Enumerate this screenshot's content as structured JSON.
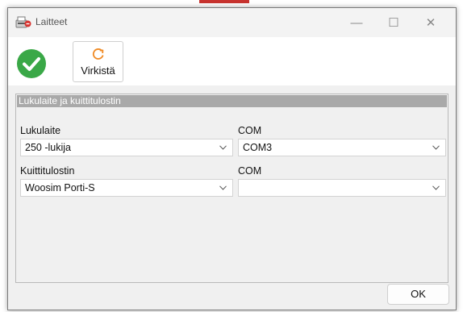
{
  "window": {
    "title": "Laitteet",
    "controls": {
      "minimize": "—",
      "maximize": "☐",
      "close": "✕"
    }
  },
  "toolbar": {
    "accept_icon": "check-circle-icon",
    "refresh_icon": "refresh-icon",
    "refresh_label": "Virkistä"
  },
  "group": {
    "title": "Lukulaite ja kuittitulostin",
    "reader": {
      "label": "Lukulaite",
      "value": "250 -lukija",
      "com_label": "COM",
      "com_value": "COM3"
    },
    "printer": {
      "label": "Kuittitulostin",
      "value": "Woosim Porti-S",
      "com_label": "COM",
      "com_value": ""
    }
  },
  "footer": {
    "ok_label": "OK"
  },
  "colors": {
    "accent_green": "#3aa847",
    "refresh_orange": "#f08a24",
    "group_header": "#a9a9a9"
  }
}
